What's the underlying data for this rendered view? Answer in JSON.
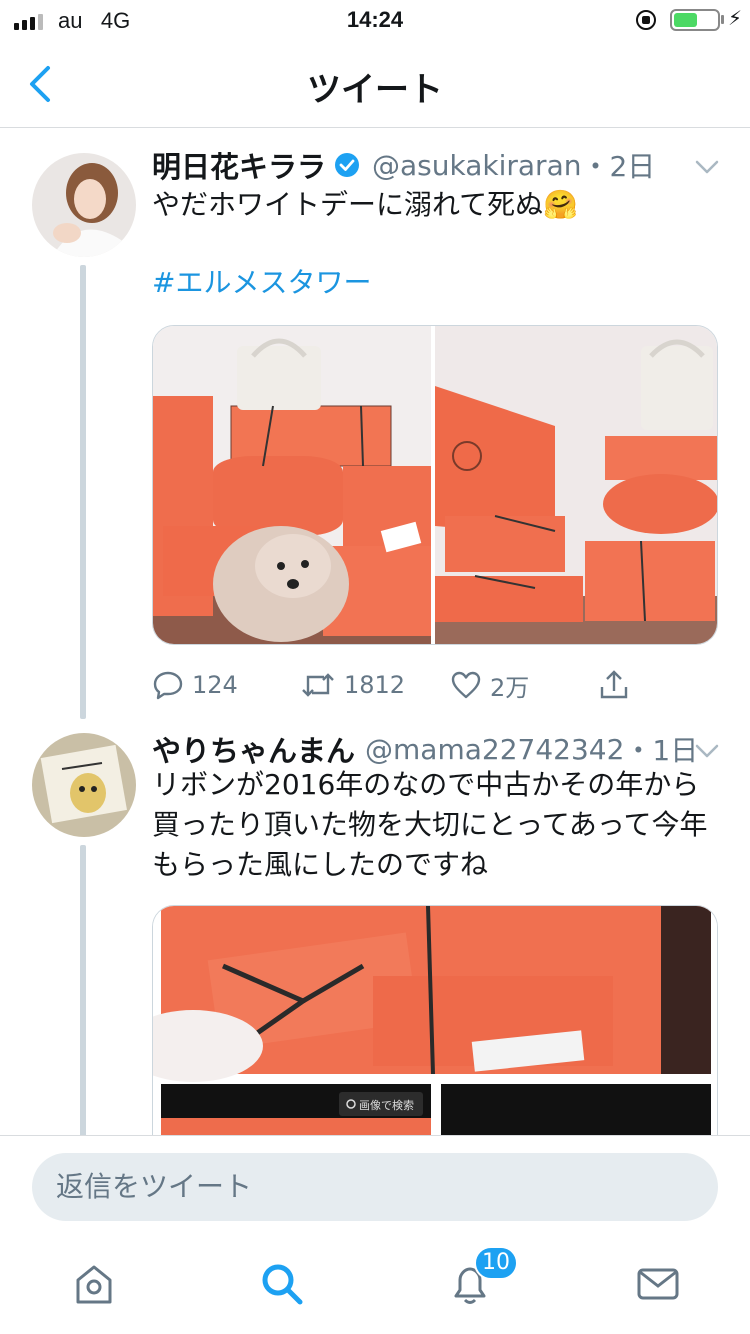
{
  "status_bar": {
    "carrier": "au",
    "network": "4G",
    "time": "14:24",
    "battery_fraction": 0.55
  },
  "nav": {
    "title": "ツイート",
    "back_icon": "chevron-left-icon"
  },
  "tweets": [
    {
      "display_name": "明日花キララ",
      "verified": true,
      "handle": "@asukakiraran",
      "time_ago": "・2日",
      "text": "やだホワイトデーに溺れて死ぬ🤗",
      "hashtag": "#エルメスタワー",
      "actions": {
        "reply_count": "124",
        "retweet_count": "1812",
        "like_count": "2万"
      }
    },
    {
      "display_name": "やりちゃんまん",
      "handle": "@mama22742342",
      "time_ago": "・1日",
      "text_lines": [
        "リボンが2016年のなので中古かその年から",
        "買ったり頂いた物を大切にとってあって今年",
        "もらった風にしたのですね"
      ],
      "image_overlay": "画像で検索"
    }
  ],
  "reply_bar": {
    "placeholder": "返信をツイート"
  },
  "tab_bar": {
    "items": [
      "home-icon",
      "search-icon",
      "notifications-icon",
      "messages-icon"
    ],
    "notification_badge": "10"
  },
  "colors": {
    "accent": "#1da1f2",
    "muted": "#657786",
    "hermes_orange": "#f0694a"
  }
}
